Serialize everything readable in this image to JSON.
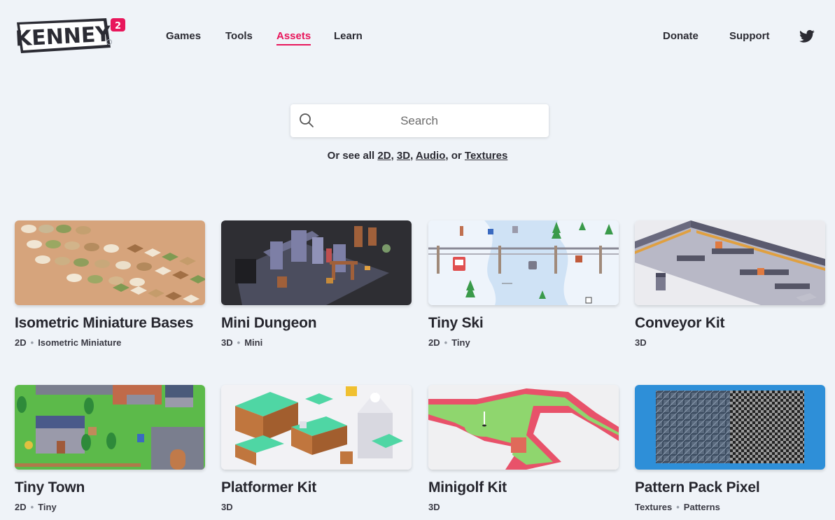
{
  "header": {
    "logo_text": "KENNEY",
    "logo_badge": "2",
    "nav": [
      {
        "label": "Games",
        "active": false
      },
      {
        "label": "Tools",
        "active": false
      },
      {
        "label": "Assets",
        "active": true
      },
      {
        "label": "Learn",
        "active": false
      }
    ],
    "right_nav": [
      {
        "label": "Donate"
      },
      {
        "label": "Support"
      }
    ],
    "social_icon": "twitter-icon"
  },
  "search": {
    "placeholder": "Search",
    "value": ""
  },
  "see_all": {
    "prefix": "Or see all",
    "links": [
      "2D",
      "3D",
      "Audio",
      "Textures"
    ],
    "sep1": ",",
    "sep2": ",",
    "sep3": ", or"
  },
  "colors": {
    "background": "#eff3f8",
    "accent": "#e8165b",
    "text": "#2b2b33"
  },
  "assets": [
    {
      "title": "Isometric Miniature Bases",
      "tags": [
        "2D",
        "Isometric Miniature"
      ]
    },
    {
      "title": "Mini Dungeon",
      "tags": [
        "3D",
        "Mini"
      ]
    },
    {
      "title": "Tiny Ski",
      "tags": [
        "2D",
        "Tiny"
      ]
    },
    {
      "title": "Conveyor Kit",
      "tags": [
        "3D"
      ]
    },
    {
      "title": "Tiny Town",
      "tags": [
        "2D",
        "Tiny"
      ]
    },
    {
      "title": "Platformer Kit",
      "tags": [
        "3D"
      ]
    },
    {
      "title": "Minigolf Kit",
      "tags": [
        "3D"
      ]
    },
    {
      "title": "Pattern Pack Pixel",
      "tags": [
        "Textures",
        "Patterns"
      ]
    }
  ]
}
